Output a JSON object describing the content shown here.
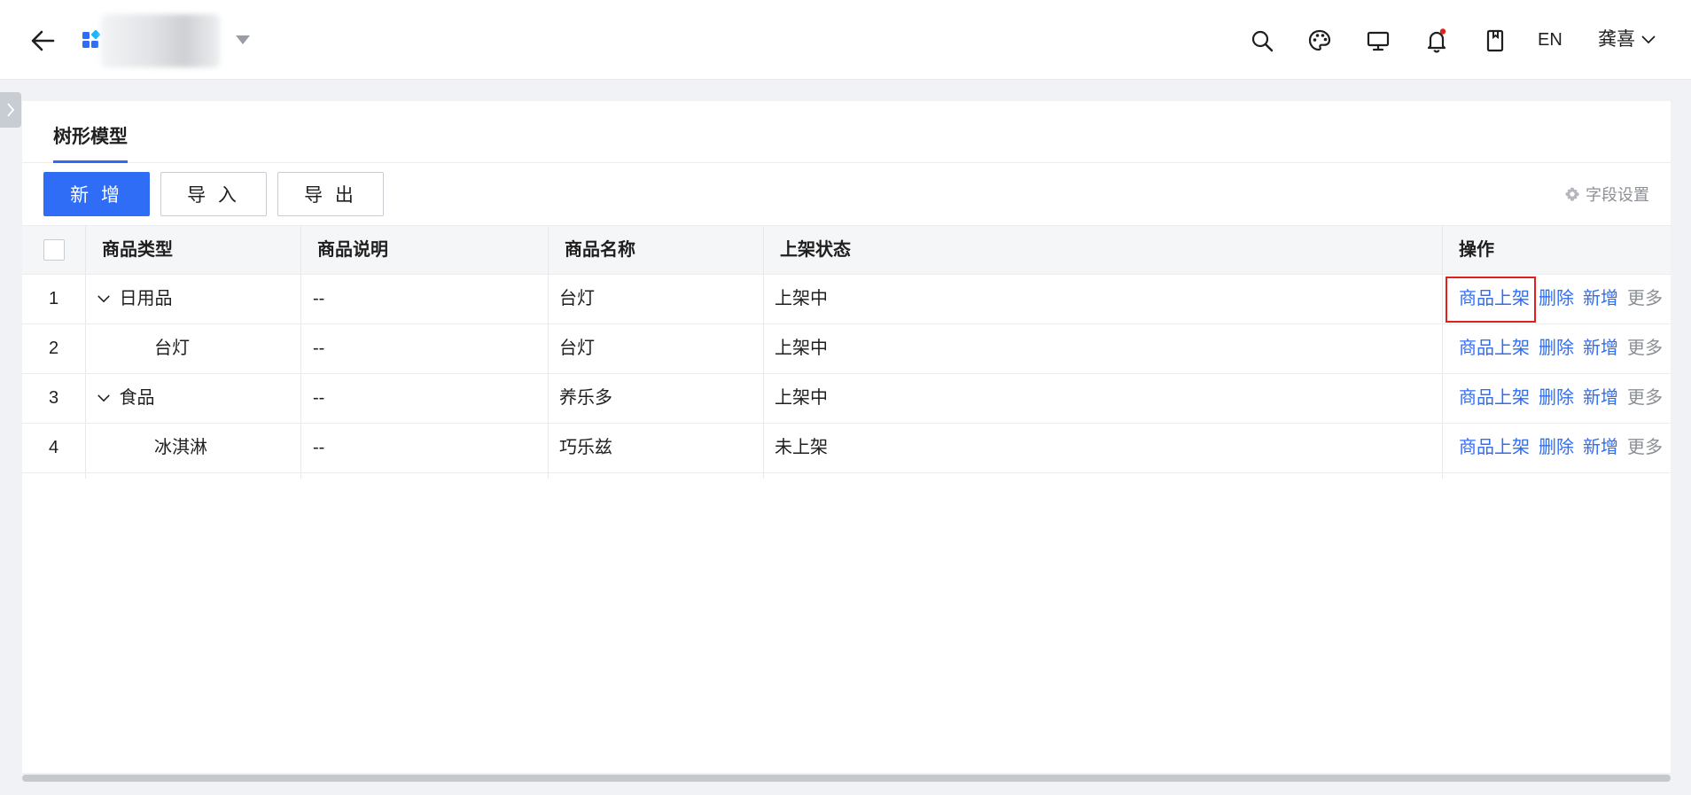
{
  "header": {
    "app_name": "",
    "language": "EN",
    "user_name": "龚喜",
    "icons": [
      "back-arrow-icon",
      "app-grid-icon",
      "search-icon",
      "palette-icon",
      "monitor-icon",
      "bell-icon",
      "book-icon"
    ],
    "notification_dot_color": "#e0201b"
  },
  "tabs": {
    "active": "树形模型"
  },
  "toolbar": {
    "add_label": "新 增",
    "import_label": "导 入",
    "export_label": "导 出",
    "field_settings_label": "字段设置"
  },
  "table": {
    "columns": [
      "商品类型",
      "商品说明",
      "商品名称",
      "上架状态",
      "操作"
    ],
    "rows": [
      {
        "index": "1",
        "type": "日用品",
        "expandable": true,
        "desc": "--",
        "name": "台灯",
        "status": "上架中"
      },
      {
        "index": "2",
        "type": "台灯",
        "expandable": false,
        "desc": "--",
        "name": "台灯",
        "status": "上架中"
      },
      {
        "index": "3",
        "type": "食品",
        "expandable": true,
        "desc": "--",
        "name": "养乐多",
        "status": "上架中"
      },
      {
        "index": "4",
        "type": "冰淇淋",
        "expandable": false,
        "desc": "--",
        "name": "巧乐兹",
        "status": "未上架"
      }
    ],
    "actions": {
      "publish": "商品上架",
      "delete": "删除",
      "add": "新增",
      "more": "更多"
    }
  },
  "colors": {
    "primary": "#2f6df6",
    "highlight": "#e0201b"
  }
}
